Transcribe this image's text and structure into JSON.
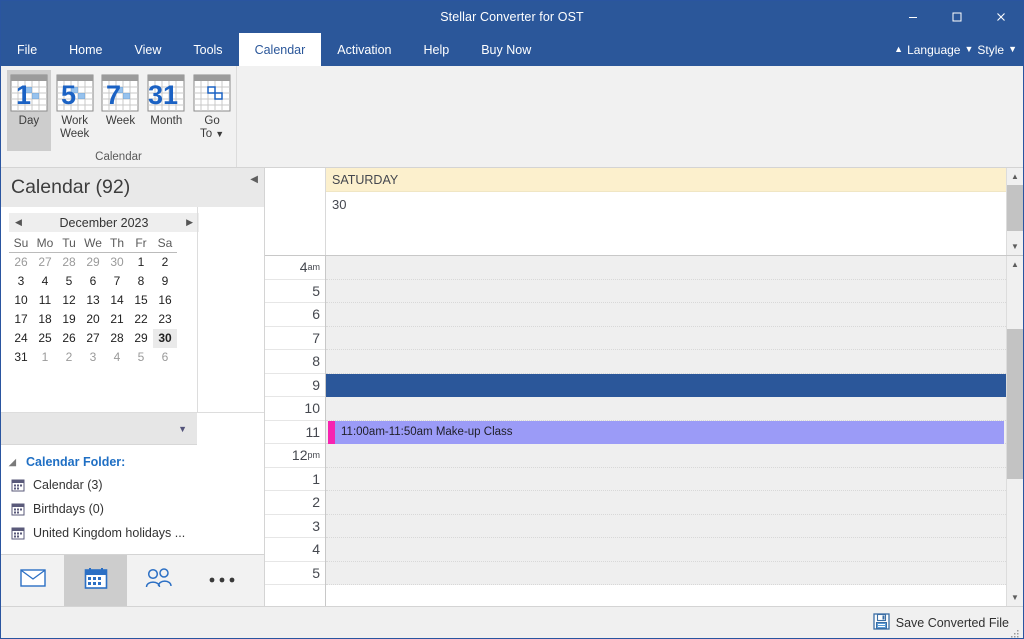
{
  "window": {
    "title": "Stellar Converter for OST",
    "minimize_label": "Minimize",
    "maximize_label": "Maximize",
    "close_label": "Close"
  },
  "menu": {
    "tabs": [
      {
        "label": "File",
        "active": false
      },
      {
        "label": "Home",
        "active": false
      },
      {
        "label": "View",
        "active": false
      },
      {
        "label": "Tools",
        "active": false
      },
      {
        "label": "Calendar",
        "active": true
      },
      {
        "label": "Activation",
        "active": false
      },
      {
        "label": "Help",
        "active": false
      },
      {
        "label": "Buy Now",
        "active": false
      }
    ],
    "language_label": "Language",
    "style_label": "Style"
  },
  "ribbon": {
    "group_title": "Calendar",
    "buttons": [
      {
        "label": "Day",
        "glyph": "1",
        "selected": true,
        "icon": "calendar-day-icon"
      },
      {
        "label": "Work\nWeek",
        "glyph": "5",
        "selected": false,
        "icon": "calendar-work-week-icon"
      },
      {
        "label": "Week",
        "glyph": "7",
        "selected": false,
        "icon": "calendar-week-icon"
      },
      {
        "label": "Month",
        "glyph": "31",
        "selected": false,
        "icon": "calendar-month-icon"
      },
      {
        "label": "Go\nTo",
        "glyph": "",
        "selected": false,
        "icon": "calendar-goto-icon",
        "has_dropdown": true
      }
    ]
  },
  "sidebar": {
    "header_title": "Calendar (92)",
    "collapse_icon": "collapse-left-icon",
    "date_nav": {
      "month_label": "December 2023",
      "prev_icon": "chevron-left-icon",
      "next_icon": "chevron-right-icon",
      "day_headers": [
        "Su",
        "Mo",
        "Tu",
        "We",
        "Th",
        "Fr",
        "Sa"
      ],
      "weeks": [
        [
          {
            "n": "26",
            "muted": true
          },
          {
            "n": "27",
            "muted": true
          },
          {
            "n": "28",
            "muted": true
          },
          {
            "n": "29",
            "muted": true
          },
          {
            "n": "30",
            "muted": true
          },
          {
            "n": "1",
            "muted": false
          },
          {
            "n": "2",
            "muted": false
          }
        ],
        [
          {
            "n": "3",
            "muted": false
          },
          {
            "n": "4",
            "muted": false
          },
          {
            "n": "5",
            "muted": false
          },
          {
            "n": "6",
            "muted": false
          },
          {
            "n": "7",
            "muted": false
          },
          {
            "n": "8",
            "muted": false
          },
          {
            "n": "9",
            "muted": false
          }
        ],
        [
          {
            "n": "10",
            "muted": false
          },
          {
            "n": "11",
            "muted": false
          },
          {
            "n": "12",
            "muted": false
          },
          {
            "n": "13",
            "muted": false
          },
          {
            "n": "14",
            "muted": false
          },
          {
            "n": "15",
            "muted": false
          },
          {
            "n": "16",
            "muted": false
          }
        ],
        [
          {
            "n": "17",
            "muted": false
          },
          {
            "n": "18",
            "muted": false
          },
          {
            "n": "19",
            "muted": false
          },
          {
            "n": "20",
            "muted": false
          },
          {
            "n": "21",
            "muted": false
          },
          {
            "n": "22",
            "muted": false
          },
          {
            "n": "23",
            "muted": false
          }
        ],
        [
          {
            "n": "24",
            "muted": false
          },
          {
            "n": "25",
            "muted": false
          },
          {
            "n": "26",
            "muted": false
          },
          {
            "n": "27",
            "muted": false
          },
          {
            "n": "28",
            "muted": false
          },
          {
            "n": "29",
            "muted": false
          },
          {
            "n": "30",
            "muted": false,
            "selected": true
          }
        ],
        [
          {
            "n": "31",
            "muted": false
          },
          {
            "n": "1",
            "muted": true
          },
          {
            "n": "2",
            "muted": true
          },
          {
            "n": "3",
            "muted": true
          },
          {
            "n": "4",
            "muted": true
          },
          {
            "n": "5",
            "muted": true
          },
          {
            "n": "6",
            "muted": true
          }
        ]
      ]
    },
    "dropdown_icon": "chevron-down-icon",
    "folder_section": {
      "title": "Calendar Folder:",
      "expander_icon": "triangle-expanded-icon",
      "items": [
        {
          "label": "Calendar (3)",
          "icon": "calendar-folder-icon"
        },
        {
          "label": "Birthdays (0)",
          "icon": "calendar-folder-icon"
        },
        {
          "label": "United Kingdom holidays ...",
          "icon": "calendar-folder-icon"
        }
      ]
    },
    "nav_buttons": [
      {
        "name": "mail",
        "icon": "mail-icon",
        "selected": false
      },
      {
        "name": "calendar",
        "icon": "calendar-icon",
        "selected": true
      },
      {
        "name": "people",
        "icon": "people-icon",
        "selected": false
      },
      {
        "name": "more",
        "icon": "ellipsis-icon",
        "selected": false
      }
    ]
  },
  "calendar_view": {
    "day_name": "SATURDAY",
    "day_number": "30",
    "hours": [
      {
        "label": "4",
        "suffix": "am"
      },
      {
        "label": "5",
        "suffix": ""
      },
      {
        "label": "6",
        "suffix": ""
      },
      {
        "label": "7",
        "suffix": ""
      },
      {
        "label": "8",
        "suffix": ""
      },
      {
        "label": "9",
        "suffix": ""
      },
      {
        "label": "10",
        "suffix": ""
      },
      {
        "label": "11",
        "suffix": ""
      },
      {
        "label": "12",
        "suffix": "pm"
      },
      {
        "label": "1",
        "suffix": ""
      },
      {
        "label": "2",
        "suffix": ""
      },
      {
        "label": "3",
        "suffix": ""
      },
      {
        "label": "4",
        "suffix": ""
      },
      {
        "label": "5",
        "suffix": ""
      }
    ],
    "selection": {
      "start_hour_index": 5,
      "duration_rows": 1
    },
    "appointments": [
      {
        "text": "11:00am-11:50am Make-up Class",
        "start_hour_index": 7,
        "duration_rows": 1,
        "body_color": "#9b9bf7",
        "stripe_color": "#f723b0"
      }
    ],
    "scrollbar_up_icon": "scroll-up-icon",
    "scrollbar_down_icon": "scroll-down-icon"
  },
  "statusbar": {
    "save_label": "Save Converted File",
    "save_icon": "save-disk-icon"
  },
  "colors": {
    "brand_blue": "#2b579a",
    "day_header_yellow": "#fcf0cd",
    "appointment_purple": "#9b9bf7",
    "appointment_stripe": "#f723b0",
    "accent_link": "#1f6fc4"
  }
}
